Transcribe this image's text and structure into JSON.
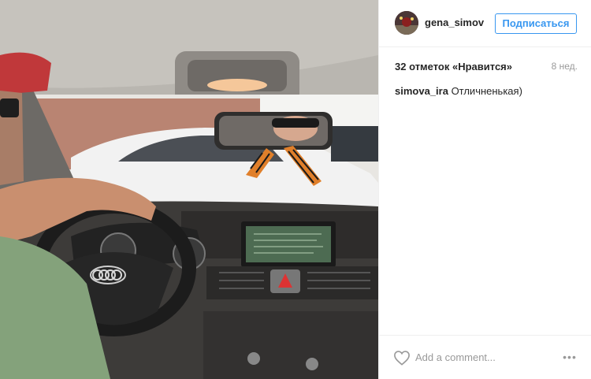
{
  "header": {
    "username": "gena_simov",
    "follow_label": "Подписаться"
  },
  "stats": {
    "likes_text": "32 отметок «Нравится»",
    "time_ago": "8 нед."
  },
  "comments": [
    {
      "user": "simova_ira",
      "text": "Отличненькая)"
    }
  ],
  "footer": {
    "add_comment_placeholder": "Add a comment...",
    "more_label": "•••"
  },
  "icons": {
    "like": "heart-icon",
    "more": "more-options-icon",
    "avatar": "avatar"
  },
  "colors": {
    "accent": "#3897f0",
    "text": "#262626",
    "muted": "#999999",
    "border": "#efefef"
  }
}
